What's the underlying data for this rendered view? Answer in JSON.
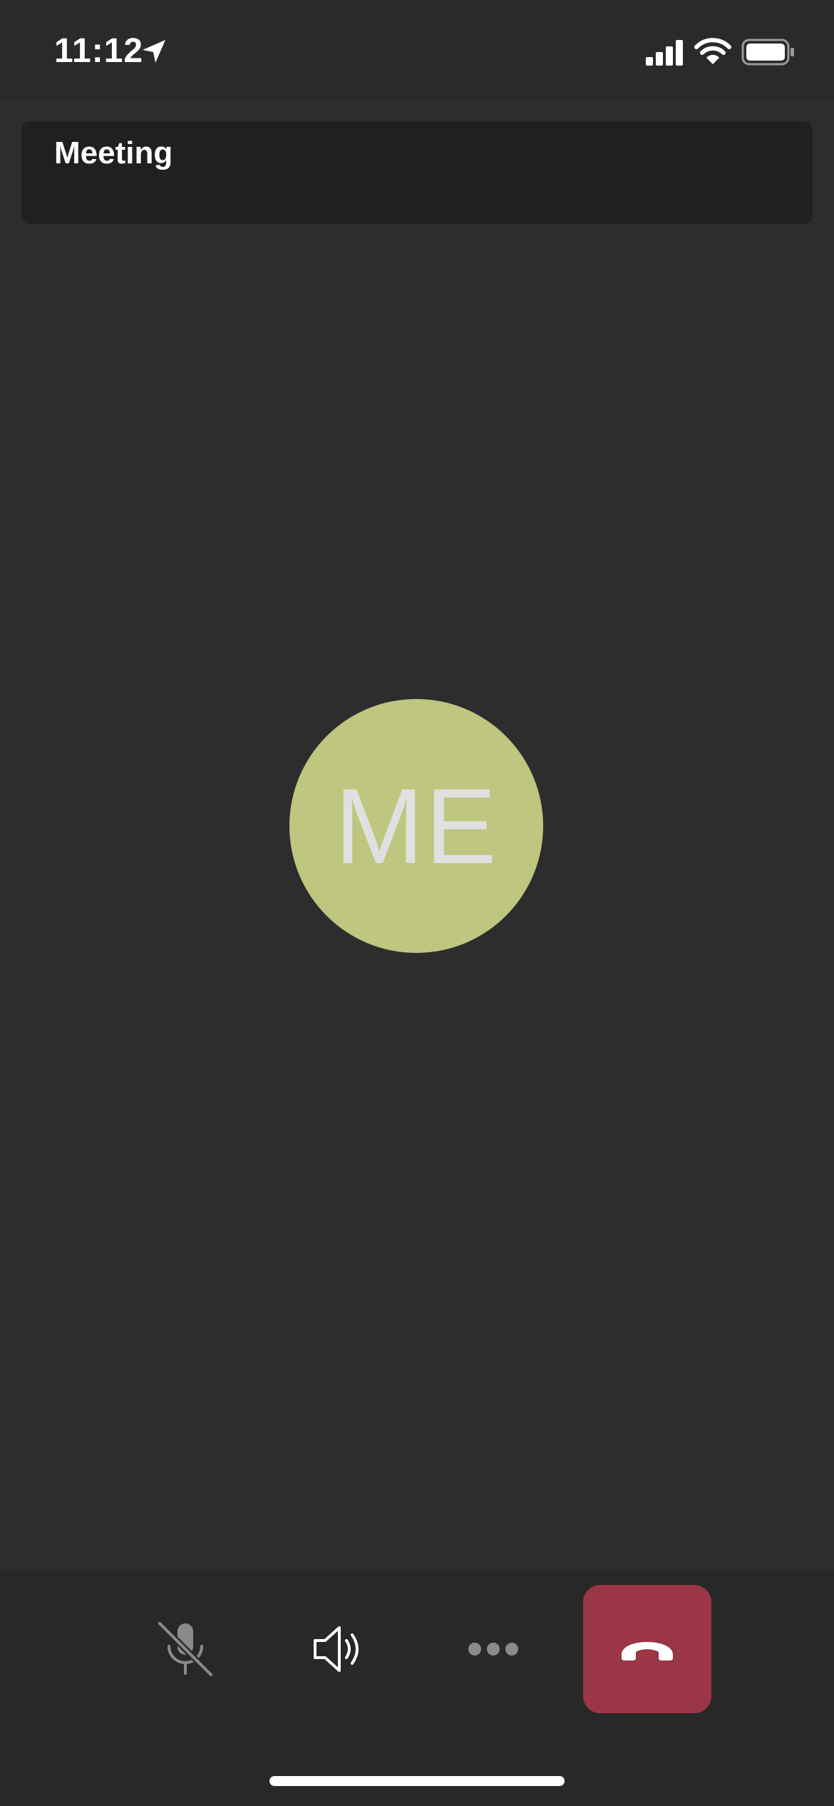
{
  "status_bar": {
    "time": "11:12",
    "icons": [
      "location-arrow-icon",
      "cellular-signal-icon",
      "wifi-icon",
      "battery-icon"
    ]
  },
  "header": {
    "title": "Meeting"
  },
  "participant": {
    "initials": "ME",
    "avatar_color": "#bec67f"
  },
  "controls": {
    "mic": {
      "icon": "microphone-muted-icon",
      "state": "muted"
    },
    "speaker": {
      "icon": "speaker-icon"
    },
    "more": {
      "icon": "more-options-icon"
    },
    "hangup": {
      "icon": "phone-hangup-icon",
      "color": "#9a3645"
    }
  },
  "colors": {
    "background": "#2d2d2d",
    "header_card": "#202020",
    "control_bar": "#282828"
  }
}
